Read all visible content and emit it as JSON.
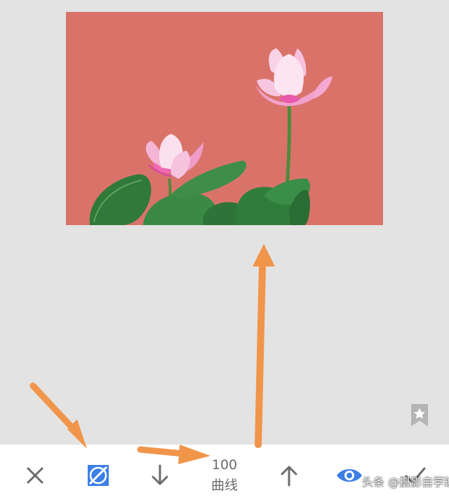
{
  "photo": {
    "background_color": "#d9736a",
    "subject": "lotus-flowers"
  },
  "toolbar": {
    "cancel_icon": "close-icon",
    "auto_icon": "auto-adjust-icon",
    "down_icon": "arrow-down-icon",
    "value": "100",
    "label": "曲线",
    "up_icon": "arrow-up-icon",
    "preview_icon": "eye-icon",
    "apply_icon": "check-icon",
    "accent_color": "#3d7fe6"
  },
  "bookmark_icon": "bookmark-star-icon",
  "watermark": {
    "text": "头条 @摄影自学班"
  },
  "annotation_color": "#f0954a"
}
